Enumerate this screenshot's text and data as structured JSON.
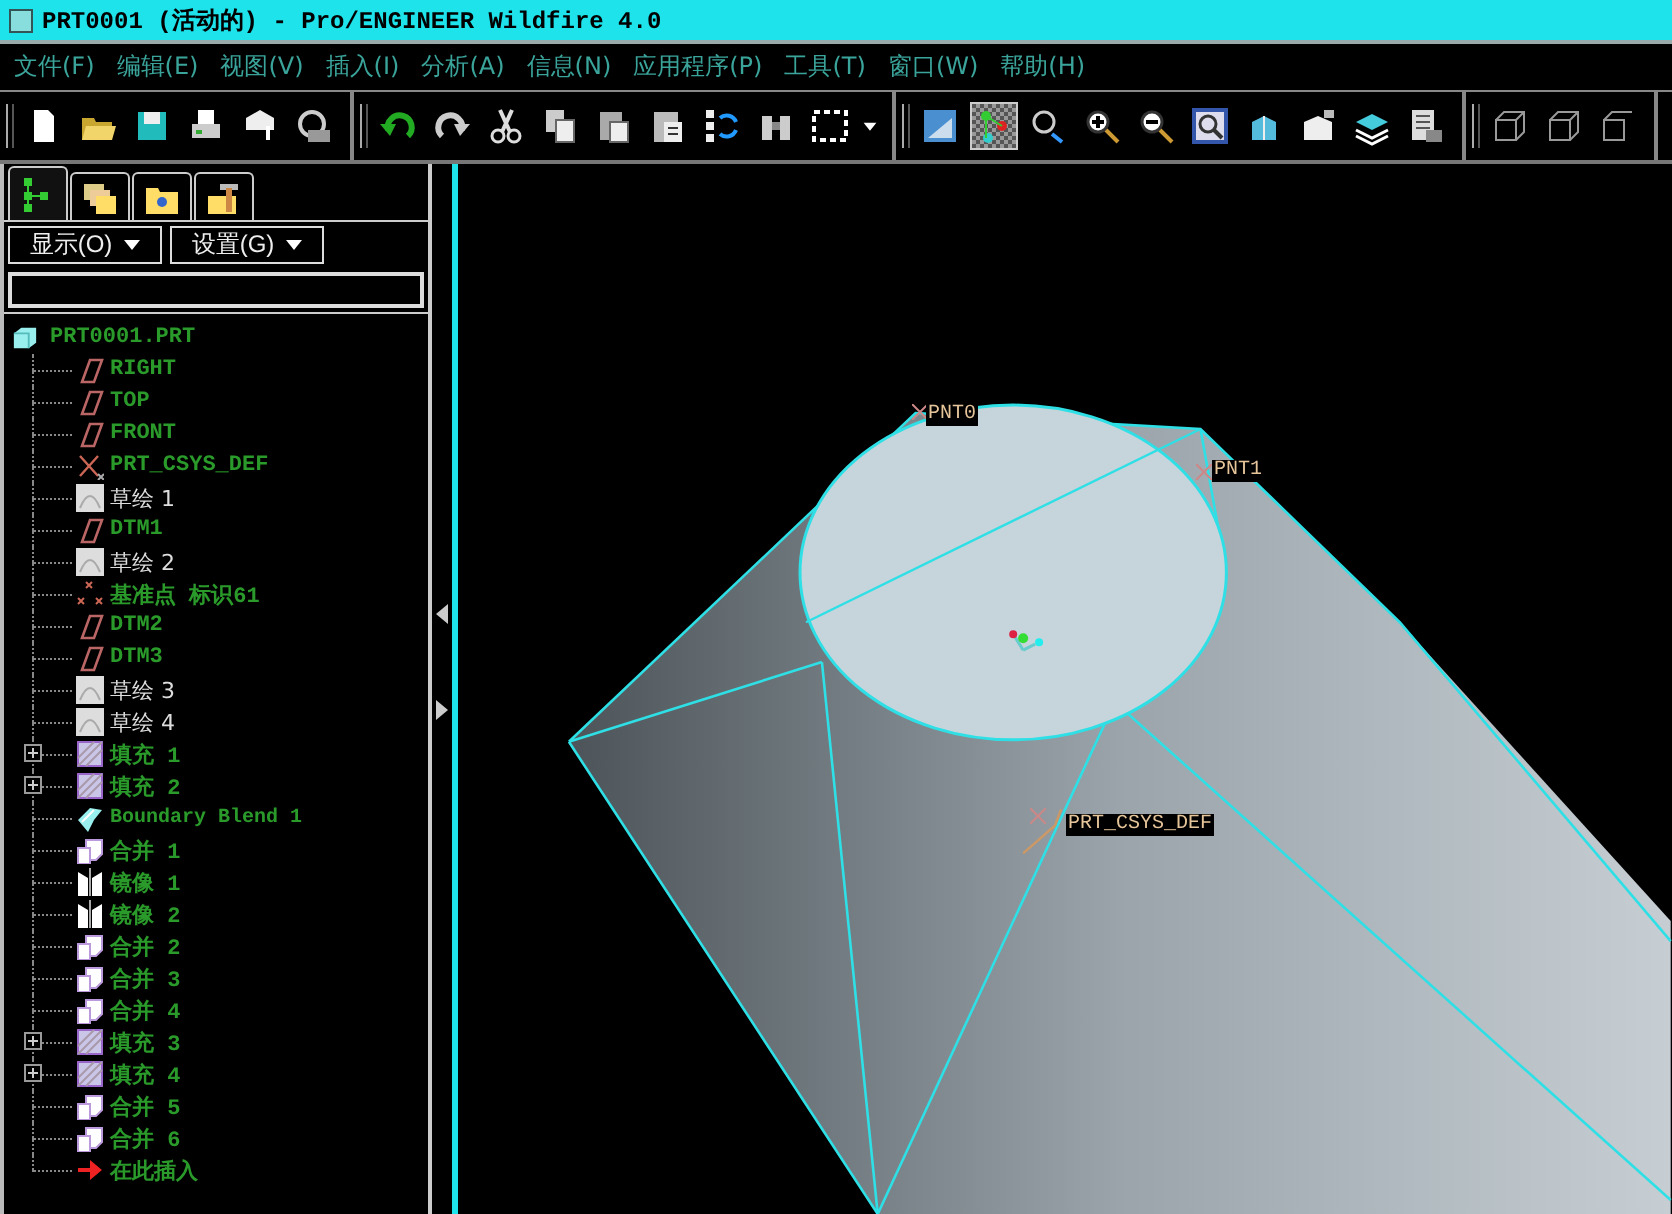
{
  "window": {
    "title": "PRT0001 (活动的) - Pro/ENGINEER Wildfire 4.0"
  },
  "menu": [
    {
      "label": "文件(F)"
    },
    {
      "label": "编辑(E)"
    },
    {
      "label": "视图(V)"
    },
    {
      "label": "插入(I)"
    },
    {
      "label": "分析(A)"
    },
    {
      "label": "信息(N)"
    },
    {
      "label": "应用程序(P)"
    },
    {
      "label": "工具(T)"
    },
    {
      "label": "窗口(W)"
    },
    {
      "label": "帮助(H)"
    }
  ],
  "toolbar": [
    {
      "items": [
        {
          "kind": "new",
          "on": false
        },
        {
          "kind": "open",
          "on": false
        },
        {
          "kind": "save",
          "on": false
        },
        {
          "kind": "print",
          "on": false
        },
        {
          "kind": "send",
          "on": false
        },
        {
          "kind": "close",
          "on": false
        }
      ]
    },
    {
      "items": [
        {
          "kind": "undo",
          "on": false
        },
        {
          "kind": "redo",
          "on": false
        },
        {
          "kind": "cut",
          "on": false
        },
        {
          "kind": "copy",
          "on": false
        },
        {
          "kind": "paste",
          "on": false
        },
        {
          "kind": "paste-special",
          "on": false
        },
        {
          "kind": "regenerate",
          "on": false
        },
        {
          "kind": "find",
          "on": false
        },
        {
          "kind": "select",
          "on": false
        },
        {
          "kind": "dropdown",
          "on": false
        }
      ]
    },
    {
      "items": [
        {
          "kind": "shade",
          "on": false
        },
        {
          "kind": "points",
          "on": true
        },
        {
          "kind": "spin",
          "on": false
        },
        {
          "kind": "zoom-in",
          "on": false
        },
        {
          "kind": "zoom-out",
          "on": false
        },
        {
          "kind": "refit",
          "on": false
        },
        {
          "kind": "orient",
          "on": false
        },
        {
          "kind": "views",
          "on": false
        },
        {
          "kind": "layers",
          "on": false
        },
        {
          "kind": "settings",
          "on": false
        }
      ]
    },
    {
      "items": [
        {
          "kind": "wireframe",
          "on": false
        },
        {
          "kind": "hidden",
          "on": false
        },
        {
          "kind": "nohidden",
          "on": false
        }
      ]
    }
  ],
  "panel": {
    "tabs": [
      {
        "kind": "tree",
        "selected": true
      },
      {
        "kind": "folders",
        "selected": false
      },
      {
        "kind": "favorites",
        "selected": false
      },
      {
        "kind": "tools",
        "selected": false
      }
    ],
    "dropdowns": [
      {
        "label": "显示(O)"
      },
      {
        "label": "设置(G)"
      }
    ],
    "tree": {
      "label": "PRT0001.PRT",
      "kind": "part",
      "children": [
        {
          "label": "RIGHT",
          "kind": "plane",
          "expandable": false
        },
        {
          "label": "TOP",
          "kind": "plane",
          "expandable": false
        },
        {
          "label": "FRONT",
          "kind": "plane",
          "expandable": false
        },
        {
          "label": "PRT_CSYS_DEF",
          "kind": "csys",
          "expandable": false
        },
        {
          "label": "草绘 1",
          "kind": "sketch",
          "expandable": false
        },
        {
          "label": "DTM1",
          "kind": "plane",
          "expandable": false
        },
        {
          "label": "草绘 2",
          "kind": "sketch",
          "expandable": false
        },
        {
          "label": "基准点 标识61",
          "kind": "point",
          "expandable": false
        },
        {
          "label": "DTM2",
          "kind": "plane",
          "expandable": false
        },
        {
          "label": "DTM3",
          "kind": "plane",
          "expandable": false
        },
        {
          "label": "草绘 3",
          "kind": "sketch",
          "expandable": false
        },
        {
          "label": "草绘 4",
          "kind": "sketch",
          "expandable": false
        },
        {
          "label": "填充 1",
          "kind": "fill",
          "expandable": true,
          "expanded": false
        },
        {
          "label": "填充 2",
          "kind": "fill",
          "expandable": true,
          "expanded": false
        },
        {
          "label": "Boundary Blend 1",
          "kind": "blend",
          "expandable": false
        },
        {
          "label": "合并 1",
          "kind": "merge",
          "expandable": false
        },
        {
          "label": "镜像 1",
          "kind": "mirror",
          "expandable": false
        },
        {
          "label": "镜像 2",
          "kind": "mirror",
          "expandable": false
        },
        {
          "label": "合并 2",
          "kind": "merge",
          "expandable": false
        },
        {
          "label": "合并 3",
          "kind": "merge",
          "expandable": false
        },
        {
          "label": "合并 4",
          "kind": "merge",
          "expandable": false
        },
        {
          "label": "填充 3",
          "kind": "fill",
          "expandable": true,
          "expanded": false
        },
        {
          "label": "填充 4",
          "kind": "fill",
          "expandable": true,
          "expanded": false
        },
        {
          "label": "合并 5",
          "kind": "merge",
          "expandable": false
        },
        {
          "label": "合并 6",
          "kind": "merge",
          "expandable": false
        },
        {
          "label": "在此插入",
          "kind": "insert",
          "expandable": false
        }
      ]
    }
  },
  "viewport": {
    "labels": [
      {
        "text": "PNT0"
      },
      {
        "text": "PNT1"
      },
      {
        "text": "PRT_CSYS_DEF"
      }
    ]
  }
}
